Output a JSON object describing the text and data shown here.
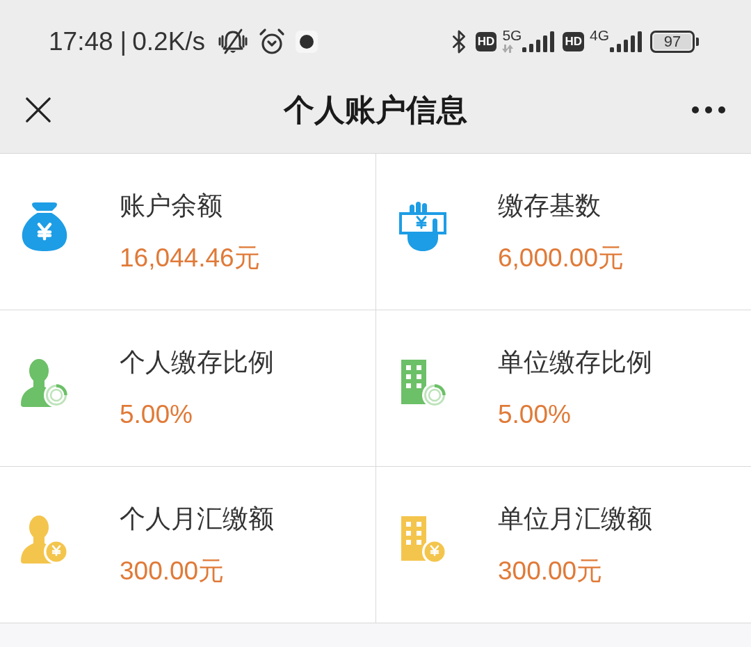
{
  "status_bar": {
    "time": "17:48",
    "separator": "|",
    "net_speed": "0.2K/s",
    "networks": [
      {
        "badge": "HD",
        "type": "5G",
        "activity": true
      },
      {
        "badge": "HD",
        "type": "4G",
        "activity": false
      }
    ],
    "battery": "97"
  },
  "nav_bar": {
    "title": "个人账户信息"
  },
  "cards": [
    {
      "kind": "money-bag",
      "color": "#1d9de5",
      "label": "账户余额",
      "value": "16,044.46元"
    },
    {
      "kind": "hand-card",
      "color": "#1d9de5",
      "label": "缴存基数",
      "value": "6,000.00元"
    },
    {
      "kind": "person-chart",
      "color": "#6cc067",
      "label": "个人缴存比例",
      "value": "5.00%"
    },
    {
      "kind": "building-chart",
      "color": "#6cc067",
      "label": "单位缴存比例",
      "value": "5.00%"
    },
    {
      "kind": "person-coin",
      "color": "#f4c54d",
      "label": "个人月汇缴额",
      "value": "300.00元"
    },
    {
      "kind": "building-coin",
      "color": "#f4c54d",
      "label": "单位月汇缴额",
      "value": "300.00元"
    }
  ]
}
